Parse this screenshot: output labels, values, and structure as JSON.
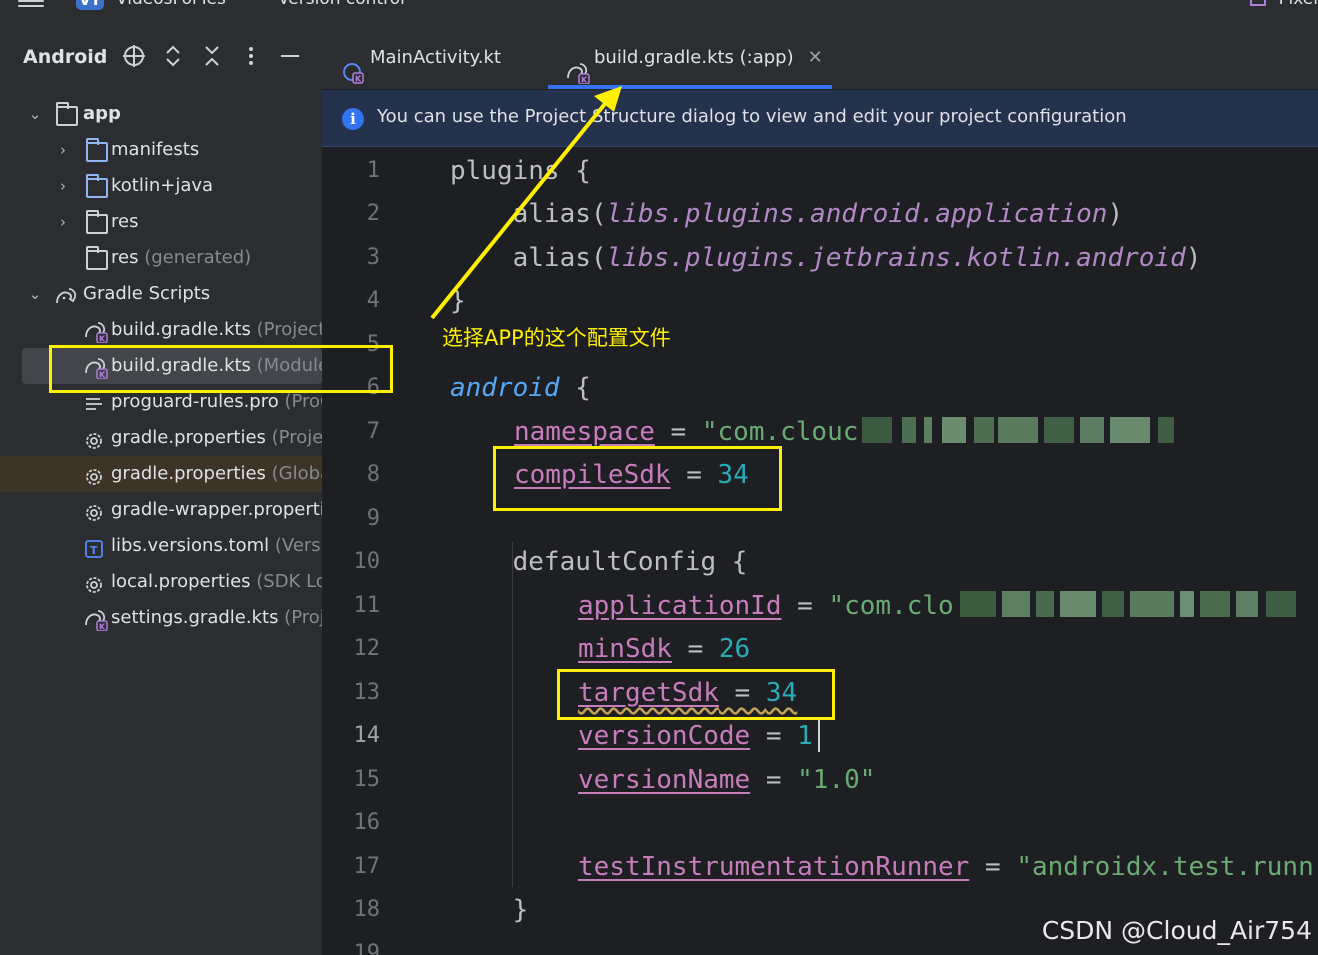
{
  "topbar": {
    "project_badge": "VT",
    "project_name": "VideosForTes",
    "vcs_label": "Version control",
    "device_label": "Pixel"
  },
  "sidebar": {
    "title": "Android",
    "tree": [
      {
        "label": "app",
        "hint": "",
        "bold": true
      },
      {
        "label": "manifests",
        "hint": ""
      },
      {
        "label": "kotlin+java",
        "hint": ""
      },
      {
        "label": "res",
        "hint": ""
      },
      {
        "label": "res",
        "hint": " (generated)"
      },
      {
        "label": "Gradle Scripts",
        "hint": ""
      },
      {
        "label": "build.gradle.kts",
        "hint": " (Project:"
      },
      {
        "label": "build.gradle.kts",
        "hint": " (Module :app)"
      },
      {
        "label": "proguard-rules.pro",
        "hint": " (ProG"
      },
      {
        "label": "gradle.properties",
        "hint": " (Projec"
      },
      {
        "label": "gradle.properties",
        "hint": " (Globa"
      },
      {
        "label": "gradle-wrapper.properti",
        "hint": ""
      },
      {
        "label": "libs.versions.toml",
        "hint": " (Versio"
      },
      {
        "label": "local.properties",
        "hint": " (SDK Loc"
      },
      {
        "label": "settings.gradle.kts",
        "hint": " (Proje"
      }
    ]
  },
  "tabs": [
    {
      "label": "MainActivity.kt"
    },
    {
      "label": "build.gradle.kts (:app)"
    }
  ],
  "banner": {
    "text": "You can use the Project Structure dialog to view and edit your project configuration"
  },
  "editor": {
    "line_numbers": [
      "1",
      "2",
      "3",
      "4",
      "5",
      "6",
      "7",
      "8",
      "9",
      "10",
      "11",
      "12",
      "13",
      "14",
      "15",
      "16",
      "17",
      "18",
      "19"
    ],
    "current_line": "14",
    "code": {
      "l1_a": "plugins",
      "l1_b": " {",
      "l2_a": "    alias(",
      "l2_b": "libs.plugins.android.application",
      "l2_c": ")",
      "l3_a": "    alias(",
      "l3_b": "libs.plugins.jetbrains.kotlin.android",
      "l3_c": ")",
      "l4": "}",
      "l6_a": "android",
      "l6_b": " {",
      "l7_prop": "namespace",
      "l7_eq": " = ",
      "l7_str": "\"com.clouc",
      "l8_prop": "compileSdk",
      "l8_eq": " = ",
      "l8_num": "34",
      "l10": "    defaultConfig {",
      "l11_prop": "applicationId",
      "l11_eq": " = ",
      "l11_str": "\"com.clo",
      "l12_prop": "minSdk",
      "l12_eq": " = ",
      "l12_num": "26",
      "l13_prop": "targetSdk",
      "l13_eq": " = ",
      "l13_num": "34",
      "l14_prop": "versionCode",
      "l14_eq": " = ",
      "l14_num": "1",
      "l15_prop": "versionName",
      "l15_eq": " = ",
      "l15_str": "\"1.0\"",
      "l17_prop": "testInstrumentationRunner",
      "l17_eq": " = ",
      "l17_str": "\"androidx.test.runn",
      "l18": "    }"
    }
  },
  "annotation": {
    "text": "选择APP的这个配置文件"
  },
  "watermark": "CSDN @Cloud_Air754",
  "colors": {
    "accent": "#3574f0",
    "annotation": "#ffef00",
    "keyword": "#b389c5",
    "property": "#c77dbb",
    "number": "#2aacb8",
    "string": "#6aab73"
  }
}
